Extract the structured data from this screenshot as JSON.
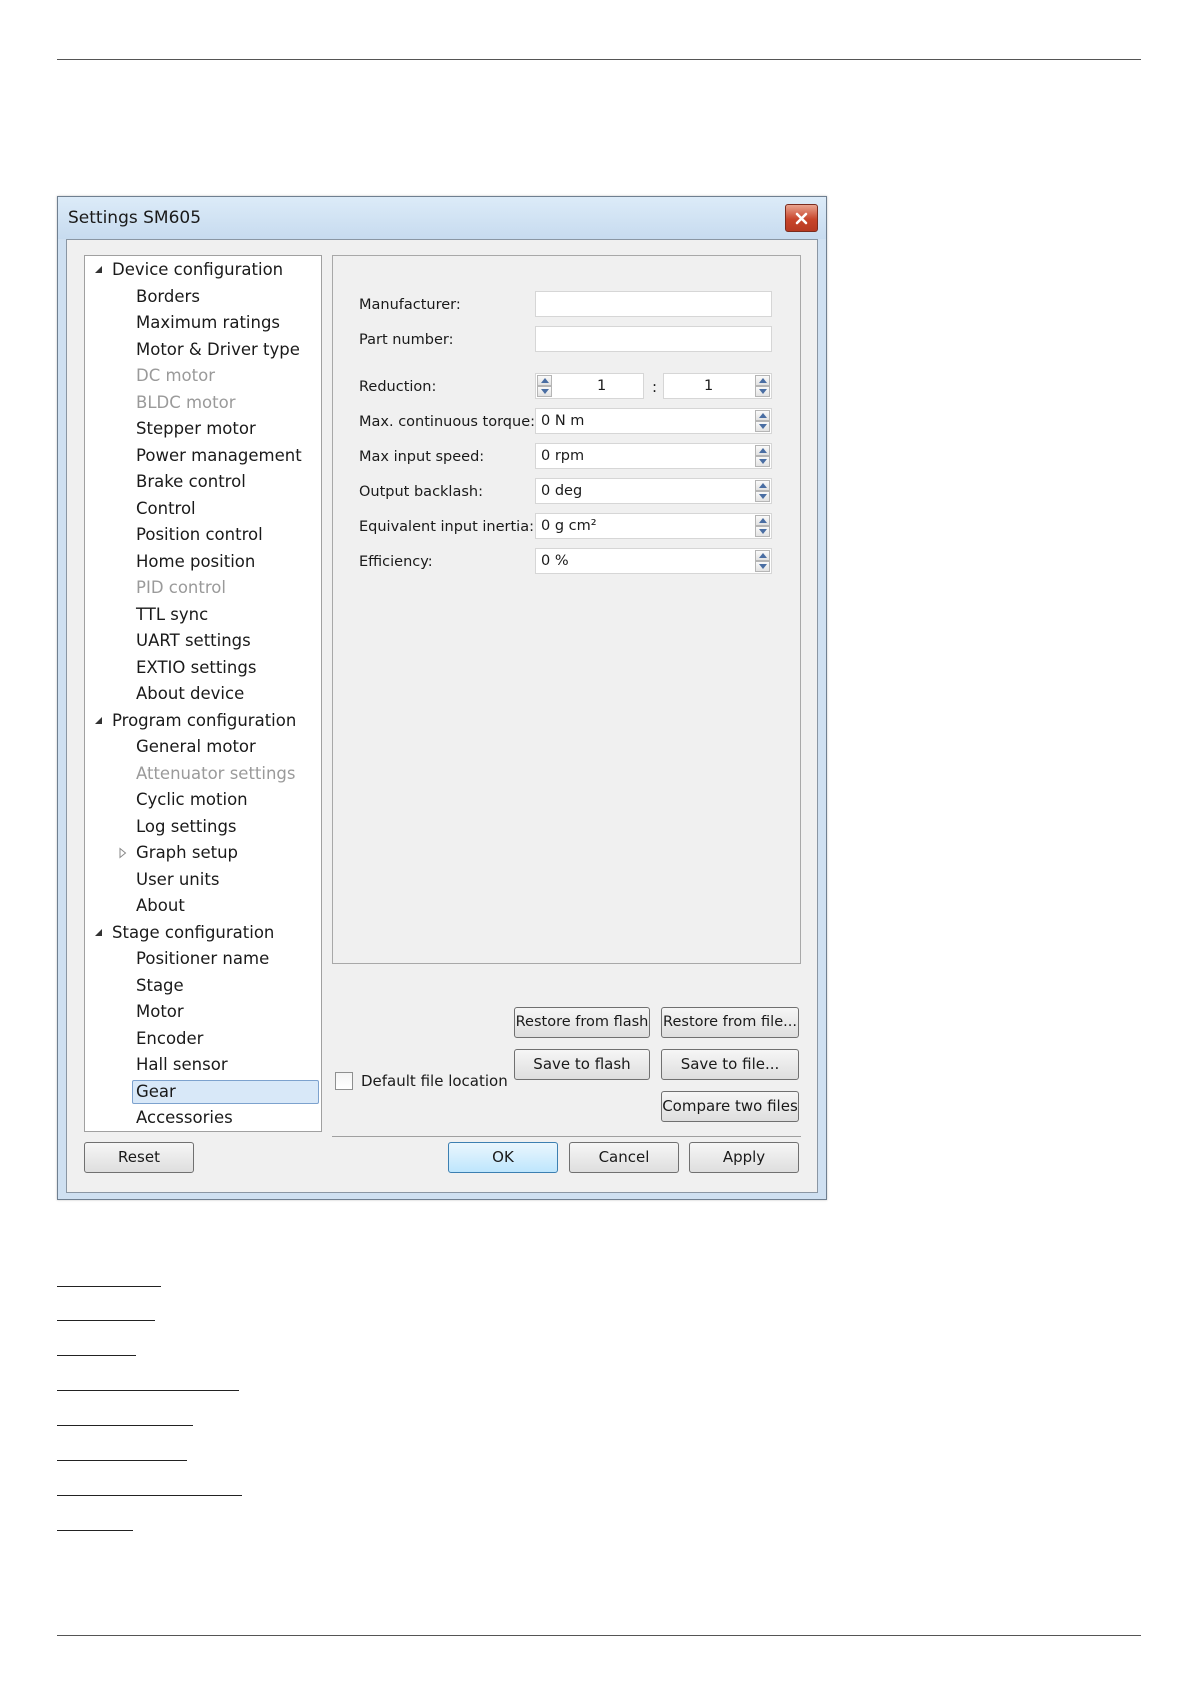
{
  "window": {
    "title": "Settings SM605"
  },
  "tree": {
    "items": [
      {
        "label": "Device configuration",
        "level": 0,
        "expander": "expanded"
      },
      {
        "label": "Borders",
        "level": 1
      },
      {
        "label": "Maximum ratings",
        "level": 1
      },
      {
        "label": "Motor & Driver type",
        "level": 1
      },
      {
        "label": "DC motor",
        "level": 1,
        "state": "disabled"
      },
      {
        "label": "BLDC motor",
        "level": 1,
        "state": "disabled"
      },
      {
        "label": "Stepper motor",
        "level": 1
      },
      {
        "label": "Power management",
        "level": 1
      },
      {
        "label": "Brake control",
        "level": 1
      },
      {
        "label": "Control",
        "level": 1
      },
      {
        "label": "Position control",
        "level": 1
      },
      {
        "label": "Home position",
        "level": 1
      },
      {
        "label": "PID control",
        "level": 1,
        "state": "disabled"
      },
      {
        "label": "TTL sync",
        "level": 1
      },
      {
        "label": "UART settings",
        "level": 1
      },
      {
        "label": "EXTIO settings",
        "level": 1
      },
      {
        "label": "About device",
        "level": 1
      },
      {
        "label": "Program configuration",
        "level": 0,
        "expander": "expanded"
      },
      {
        "label": "General motor",
        "level": 1
      },
      {
        "label": "Attenuator settings",
        "level": 1,
        "state": "disabled"
      },
      {
        "label": "Cyclic motion",
        "level": 1
      },
      {
        "label": "Log settings",
        "level": 1
      },
      {
        "label": "Graph setup",
        "level": 1,
        "expander": "collapsed"
      },
      {
        "label": "User units",
        "level": 1
      },
      {
        "label": "About",
        "level": 1
      },
      {
        "label": "Stage configuration",
        "level": 0,
        "expander": "expanded"
      },
      {
        "label": "Positioner name",
        "level": 1
      },
      {
        "label": "Stage",
        "level": 1
      },
      {
        "label": "Motor",
        "level": 1
      },
      {
        "label": "Encoder",
        "level": 1
      },
      {
        "label": "Hall sensor",
        "level": 1
      },
      {
        "label": "Gear",
        "level": 1,
        "state": "selected"
      },
      {
        "label": "Accessories",
        "level": 1
      }
    ]
  },
  "form": {
    "manufacturer": {
      "label": "Manufacturer:",
      "value": ""
    },
    "part_number": {
      "label": "Part number:",
      "value": ""
    },
    "reduction": {
      "label": "Reduction:",
      "input": "1",
      "separator": ":",
      "output": "1"
    },
    "max_torque": {
      "label": "Max. continuous torque:",
      "value": "0 N m"
    },
    "max_speed": {
      "label": "Max input speed:",
      "value": "0 rpm"
    },
    "backlash": {
      "label": "Output backlash:",
      "value": "0 deg"
    },
    "inertia": {
      "label": "Equivalent input inertia:",
      "value": "0 g cm²"
    },
    "efficiency": {
      "label": "Efficiency:",
      "value": "0 %"
    }
  },
  "file_buttons": {
    "restore_flash": "Restore from flash",
    "restore_file": "Restore from file...",
    "save_flash": "Save to flash",
    "save_file": "Save to file...",
    "compare": "Compare two files"
  },
  "default_location": {
    "label": "Default file location",
    "checked": false
  },
  "dialog_buttons": {
    "reset": "Reset",
    "ok": "OK",
    "cancel": "Cancel",
    "apply": "Apply"
  },
  "colors": {
    "close_button": "#c8452b",
    "selection": "#d8e8f8",
    "default_button": "#bee6fd"
  }
}
